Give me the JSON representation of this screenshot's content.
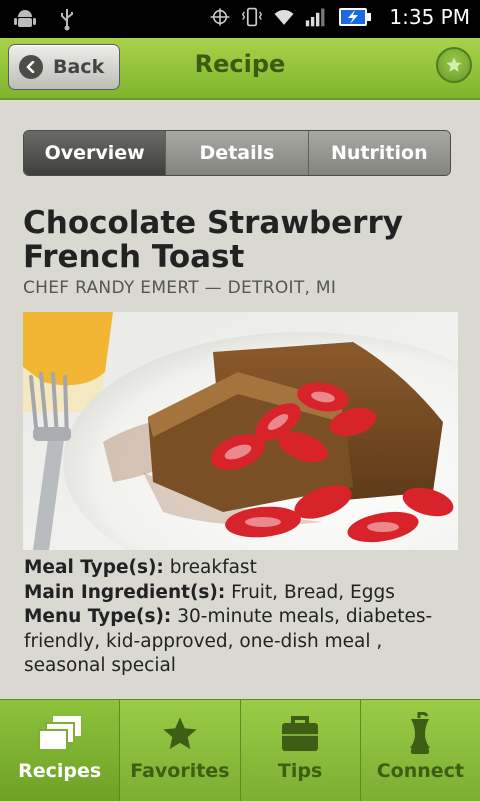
{
  "status_bar": {
    "time": "1:35 PM",
    "icons": [
      "android-debug-icon",
      "usb-icon",
      "gps-icon",
      "vibrate-icon",
      "wifi-icon",
      "signal-icon",
      "battery-charging-icon"
    ]
  },
  "action_bar": {
    "back_label": "Back",
    "title": "Recipe",
    "favorite_icon": "star-icon"
  },
  "tabs": [
    {
      "label": "Overview",
      "active": true
    },
    {
      "label": "Details",
      "active": false
    },
    {
      "label": "Nutrition",
      "active": false
    }
  ],
  "recipe": {
    "title": "Chocolate Strawberry French Toast",
    "chef": "CHEF RANDY EMERT — DETROIT, MI",
    "meal_type_label": "Meal Type(s):",
    "meal_type_value": " breakfast",
    "main_ingredient_label": "Main Ingredient(s):",
    "main_ingredient_value": " Fruit, Bread, Eggs",
    "menu_type_label": "Menu Type(s):",
    "menu_type_value": " 30-minute meals, diabetes-friendly, kid-approved, one-dish meal , seasonal special"
  },
  "bottom_nav": [
    {
      "label": "Recipes",
      "icon": "stacked-cards-icon",
      "active": true
    },
    {
      "label": "Favorites",
      "icon": "star-icon",
      "active": false
    },
    {
      "label": "Tips",
      "icon": "briefcase-icon",
      "active": false
    },
    {
      "label": "Connect",
      "icon": "apple-core-icon",
      "active": false
    }
  ],
  "colors": {
    "accent_green": "#8cc03a",
    "title_green": "#3d5a12",
    "background": "#d9d8d1"
  }
}
